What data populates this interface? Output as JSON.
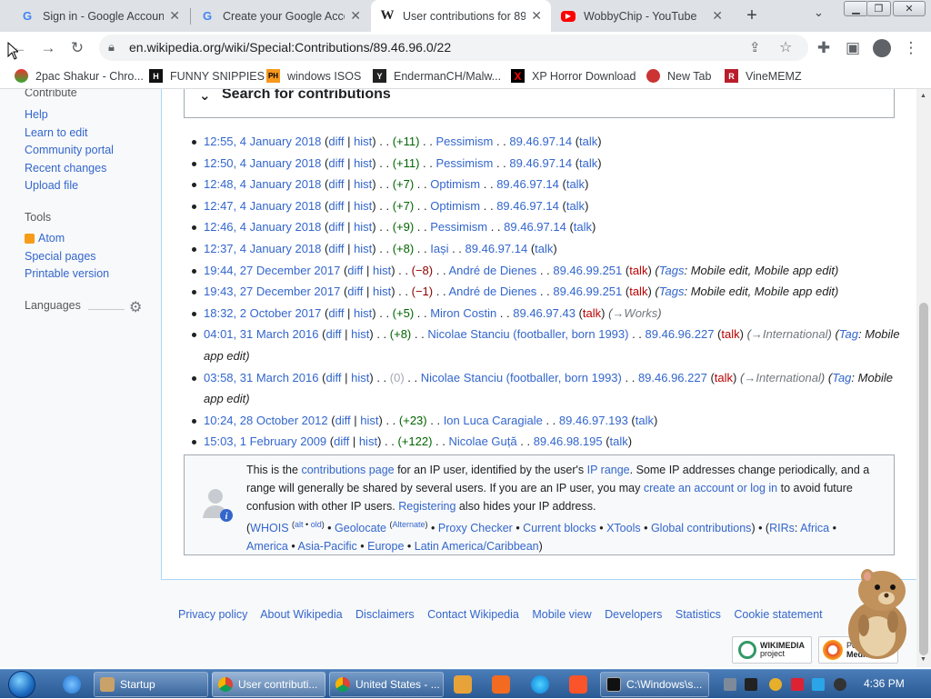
{
  "browser": {
    "tabs": [
      {
        "title": "Sign in - Google Accounts",
        "favicon": "G"
      },
      {
        "title": "Create your Google Account",
        "favicon": "G"
      },
      {
        "title": "User contributions for 89.46.96.0/22",
        "favicon": "W"
      },
      {
        "title": "WobbyChip - YouTube",
        "favicon": "▶"
      }
    ],
    "url": "en.wikipedia.org/wiki/Special:Contributions/89.46.96.0/22",
    "bookmarks": [
      {
        "label": "2pac Shakur - Chro..."
      },
      {
        "label": "FUNNY SNIPPIES"
      },
      {
        "label": "windows ISOS"
      },
      {
        "label": "EndermanCH/Malw..."
      },
      {
        "label": "XP Horror Download"
      },
      {
        "label": "New Tab"
      },
      {
        "label": "VineMEMZ"
      }
    ]
  },
  "sidebar": {
    "contribute_heading": "Contribute",
    "contribute_links": [
      "Help",
      "Learn to edit",
      "Community portal",
      "Recent changes",
      "Upload file"
    ],
    "tools_heading": "Tools",
    "tools_links": [
      "Atom",
      "Special pages",
      "Printable version"
    ],
    "languages_heading": "Languages"
  },
  "search_section": {
    "label": "Search for contributions"
  },
  "contributions": [
    {
      "ts": "12:55, 4 January 2018",
      "diff": "diff",
      "hist": "hist",
      "size": "(+11)",
      "page": "Pessimism",
      "user": "89.46.97.14",
      "talk": "talk"
    },
    {
      "ts": "12:50, 4 January 2018",
      "diff": "diff",
      "hist": "hist",
      "size": "(+11)",
      "page": "Pessimism",
      "user": "89.46.97.14",
      "talk": "talk"
    },
    {
      "ts": "12:48, 4 January 2018",
      "diff": "diff",
      "hist": "hist",
      "size": "(+7)",
      "page": "Optimism",
      "user": "89.46.97.14",
      "talk": "talk"
    },
    {
      "ts": "12:47, 4 January 2018",
      "diff": "diff",
      "hist": "hist",
      "size": "(+7)",
      "page": "Optimism",
      "user": "89.46.97.14",
      "talk": "talk"
    },
    {
      "ts": "12:46, 4 January 2018",
      "diff": "diff",
      "hist": "hist",
      "size": "(+9)",
      "page": "Pessimism",
      "user": "89.46.97.14",
      "talk": "talk"
    },
    {
      "ts": "12:37, 4 January 2018",
      "diff": "diff",
      "hist": "hist",
      "size": "(+8)",
      "page": "Iași",
      "user": "89.46.97.14",
      "talk": "talk"
    },
    {
      "ts": "19:44, 27 December 2017",
      "diff": "diff",
      "hist": "hist",
      "size": "(−8)",
      "page": "André de Dienes",
      "user": "89.46.99.251",
      "talk": "talk",
      "tags_label": "Tags",
      "tags": "Mobile edit, Mobile app edit"
    },
    {
      "ts": "19:43, 27 December 2017",
      "diff": "diff",
      "hist": "hist",
      "size": "(−1)",
      "page": "André de Dienes",
      "user": "89.46.99.251",
      "talk": "talk",
      "tags_label": "Tags",
      "tags": "Mobile edit, Mobile app edit"
    },
    {
      "ts": "18:32, 2 October 2017",
      "diff": "diff",
      "hist": "hist",
      "size": "(+5)",
      "page": "Miron Costin",
      "user": "89.46.97.43",
      "talk": "talk",
      "section": "→Works"
    },
    {
      "ts": "04:01, 31 March 2016",
      "diff": "diff",
      "hist": "hist",
      "size": "(+8)",
      "page": "Nicolae Stanciu (footballer, born 1993)",
      "user": "89.46.96.227",
      "talk": "talk",
      "section": "→International",
      "tags_label": "Tag",
      "tags": "Mobile app edit"
    },
    {
      "ts": "03:58, 31 March 2016",
      "diff": "diff",
      "hist": "hist",
      "size": "(0)",
      "page": "Nicolae Stanciu (footballer, born 1993)",
      "user": "89.46.96.227",
      "talk": "talk",
      "section": "→International",
      "tags_label": "Tag",
      "tags": "Mobile app edit"
    },
    {
      "ts": "10:24, 28 October 2012",
      "diff": "diff",
      "hist": "hist",
      "size": "(+23)",
      "page": "Ion Luca Caragiale",
      "user": "89.46.97.193",
      "talk": "talk"
    },
    {
      "ts": "15:03, 1 February 2009",
      "diff": "diff",
      "hist": "hist",
      "size": "(+122)",
      "page": "Nicolae Guță",
      "user": "89.46.98.195",
      "talk": "talk"
    }
  ],
  "infobox": {
    "t1": "This is the ",
    "contributions_page": "contributions page",
    "t2": " for an IP user, identified by the user's ",
    "ip_range": "IP range",
    "t3": ". Some IP addresses change periodically, and a range will generally be shared by several users. If you are an IP user, you may ",
    "create_account": "create an account or log in",
    "t4": " to avoid future confusion with other IP users. ",
    "registering": "Registering",
    "t5": " also hides your IP address.",
    "whois": "WHOIS",
    "alt": "alt",
    "old": "old",
    "geolocate": "Geolocate",
    "alternate": "Alternate",
    "proxy": "Proxy Checker",
    "blocks": "Current blocks",
    "xtools": "XTools",
    "global": "Global contributions",
    "rirs": "RIRs",
    "africa": "Africa",
    "america": "America",
    "asia": "Asia-Pacific",
    "europe": "Europe",
    "latam": "Latin America/Caribbean"
  },
  "footer": {
    "links": [
      "Privacy policy",
      "About Wikipedia",
      "Disclaimers",
      "Contact Wikipedia",
      "Mobile view",
      "Developers",
      "Statistics",
      "Cookie statement"
    ],
    "wikimedia_badge": "WIKIMEDIA",
    "wikimedia_sub": "project",
    "mediawiki_badge": "MediaWiki",
    "mediawiki_top": "Powered by"
  },
  "taskbar": {
    "buttons": [
      "Startup",
      "User contributi...",
      "United States - ...",
      "C:\\Windows\\s..."
    ],
    "clock": "4:36 PM"
  }
}
